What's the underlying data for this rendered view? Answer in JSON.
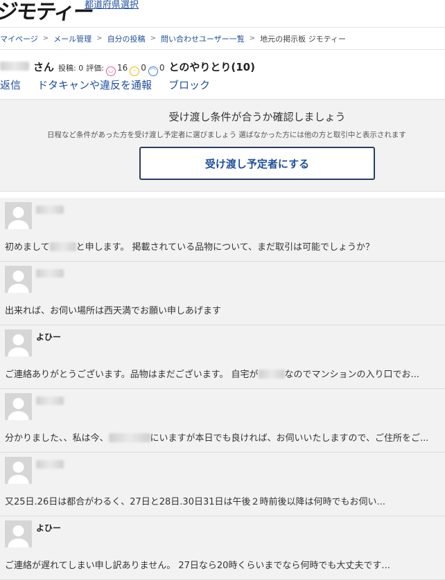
{
  "header": {
    "logo": "ジモティー",
    "pref_link": "都道府県選択"
  },
  "breadcrumb": [
    {
      "label": "マイページ",
      "link": true
    },
    {
      "label": "メール管理",
      "link": true
    },
    {
      "label": "自分の投稿",
      "link": true
    },
    {
      "label": "問い合わせユーザー一覧",
      "link": true
    },
    {
      "label": "地元の掲示板 ジモティー",
      "link": false
    }
  ],
  "breadcrumb_sep": ">",
  "thread": {
    "san": "さん",
    "posts_label": "投稿: 0",
    "rating_label": "評価:",
    "good_count": "16",
    "normal_count": "0",
    "bad_count": "0",
    "with_label": "とのやりとり(10)"
  },
  "actions": {
    "reply": "返信",
    "report": "ドタキャンや違反を通報",
    "block": "ブロック"
  },
  "confirm": {
    "title": "受け渡し条件が合うか確認しましょう",
    "description": "日程など条件があった方を受け渡し予定者に選びましょう 選ばなかった方には他の方と取引中と表示されます",
    "button": "受け渡し予定者にする"
  },
  "messages": [
    {
      "name": "",
      "text_before": "初めまして",
      "text_after": "と申します。 掲載されている品物について、まだ取引は可能でしょうか？"
    },
    {
      "name": "",
      "text_before": "出来れば、お伺い場所は西天満でお願い申しあげます",
      "text_after": ""
    },
    {
      "name": "よひー",
      "text_before": "ご連絡ありがとうございます。品物はまだございます。 自宅が",
      "text_after": "なのでマンションの入り口でお..."
    },
    {
      "name": "",
      "text_before": "分かりました、、私は今、",
      "text_after": "にいますが本日でも良ければ、お伺いいたしますので、ご住所をご..."
    },
    {
      "name": "",
      "text_before": "又25日.26日は都合がわるく、27日と28日.30日31日は午後２時前後以降は何時でもお伺い...",
      "text_after": ""
    },
    {
      "name": "よひー",
      "text_before": "ご連絡が遅れてしまい申し訳ありません。 27日なら20時くらいまでなら何時でも大丈夫です...",
      "text_after": ""
    }
  ],
  "colors": {
    "link": "#1d4e9e",
    "button_border": "#2a3b5e",
    "panel_bg": "#f2f2f2"
  }
}
